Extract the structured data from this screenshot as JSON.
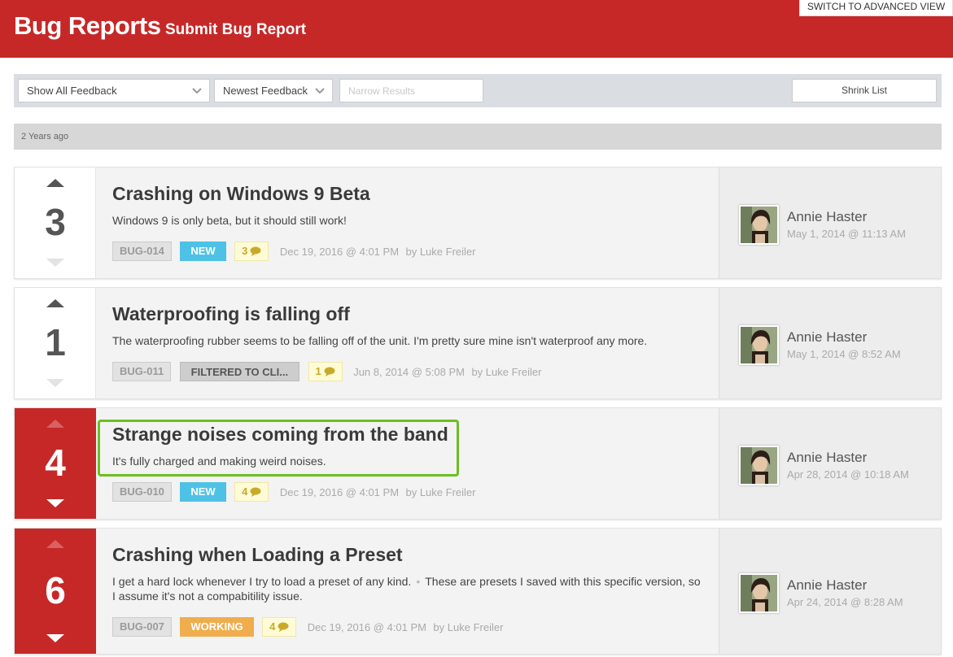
{
  "header": {
    "title": "Bug Reports",
    "subtitle": "Submit Bug Report",
    "advanced_view": "SWITCH TO ADVANCED VIEW"
  },
  "toolbar": {
    "filter_select": "Show All Feedback",
    "sort_select": "Newest Feedback",
    "search_placeholder": "Narrow Results",
    "shrink_label": "Shrink List"
  },
  "divider": {
    "label": "2 Years ago"
  },
  "reports": [
    {
      "votes": "3",
      "title": "Crashing on Windows 9 Beta",
      "description": "Windows 9 is only beta, but it should still work!",
      "id": "BUG-014",
      "status": "NEW",
      "comments": "3",
      "date": "Dec 19, 2016 @ 4:01 PM",
      "by": "by Luke Freiler",
      "author": "Annie Haster",
      "author_date": "May 1, 2014 @ 11:13 AM"
    },
    {
      "votes": "1",
      "title": "Waterproofing is falling off",
      "description": "The waterproofing rubber seems to be falling off of the unit. I'm pretty sure mine isn't waterproof any more.",
      "id": "BUG-011",
      "status": "FILTERED TO CLI...",
      "comments": "1",
      "date": "Jun 8, 2014 @ 5:08 PM",
      "by": "by Luke Freiler",
      "author": "Annie Haster",
      "author_date": "May 1, 2014 @ 8:52 AM"
    },
    {
      "votes": "4",
      "title": "Strange noises coming from the band",
      "description": "It's fully charged and making weird noises.",
      "id": "BUG-010",
      "status": "NEW",
      "comments": "4",
      "date": "Dec 19, 2016 @ 4:01 PM",
      "by": "by Luke Freiler",
      "author": "Annie Haster",
      "author_date": "Apr 28, 2014 @ 10:18 AM"
    },
    {
      "votes": "6",
      "title": "Crashing when Loading a Preset",
      "description": "I get a hard lock whenever I try to load a preset of any kind.",
      "description_extra": "These are presets I saved with this specific version, so I assume it's not a compabitility issue.",
      "id": "BUG-007",
      "status": "WORKING",
      "comments": "4",
      "date": "Dec 19, 2016 @ 4:01 PM",
      "by": "by Luke Freiler",
      "author": "Annie Haster",
      "author_date": "Apr 24, 2014 @ 8:28 AM"
    }
  ],
  "colors": {
    "brand_red": "#c62828",
    "status_new": "#4ec2e6",
    "status_working": "#f0ad4e",
    "highlight_green": "#6cbf1f"
  }
}
